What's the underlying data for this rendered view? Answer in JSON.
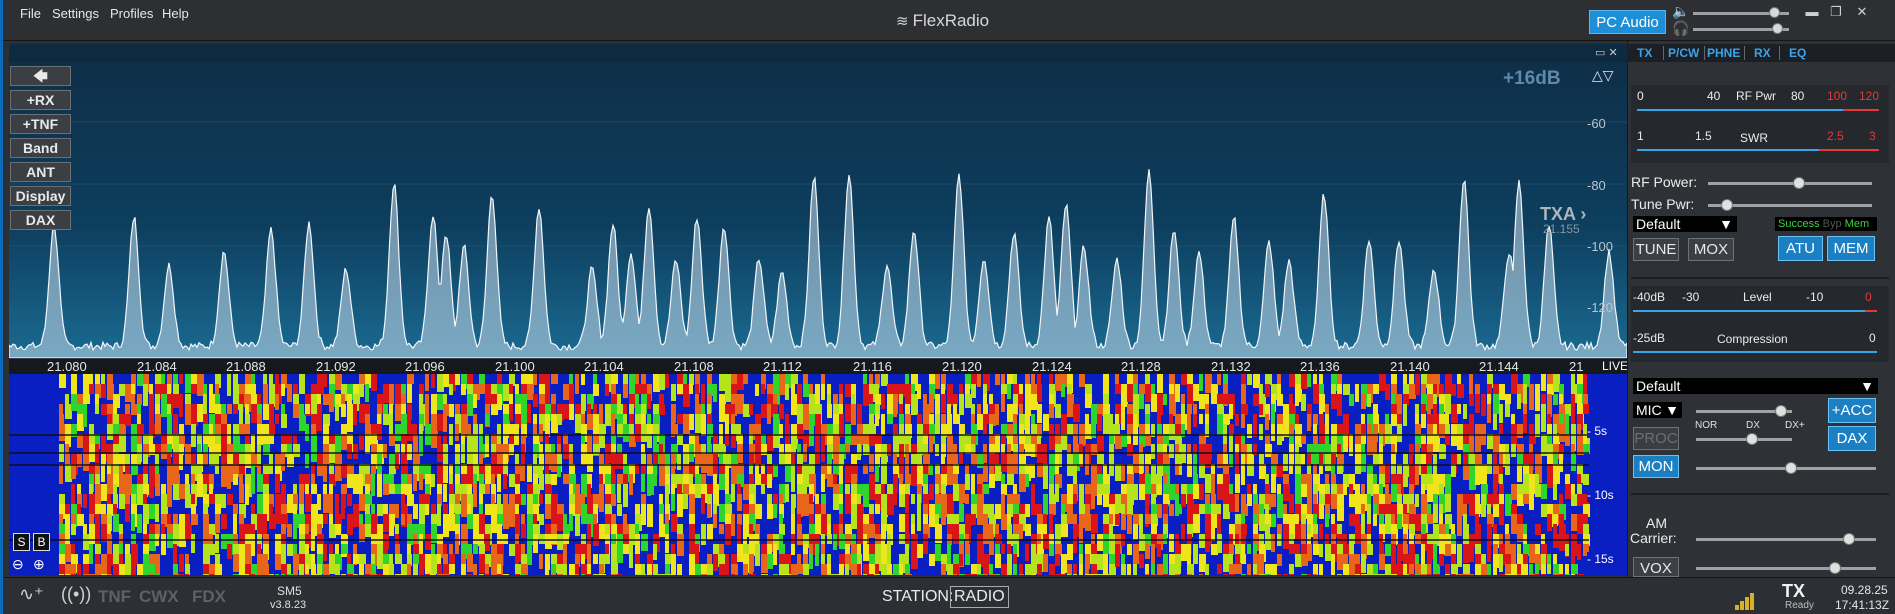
{
  "menu": {
    "items": [
      "File",
      "Settings",
      "Profiles",
      "Help"
    ]
  },
  "brand": "FlexRadio",
  "titlebar": {
    "pc_audio_label": "PC Audio",
    "speaker_icon": "speaker-icon",
    "headphones_icon": "headphones-icon",
    "minimize": "▬",
    "maximize": "❐",
    "close": "✕",
    "colors": {
      "pc_audio_bg": "#1e8fd6",
      "accent_blue": "#3aa4e8"
    }
  },
  "panadapter": {
    "buttons": [
      "+RX",
      "+TNF",
      "Band",
      "ANT",
      "Display",
      "DAX"
    ],
    "collapse_arrow": "🡄",
    "db_offset": "+16dB",
    "db_ticks": [
      "-60",
      "-80",
      "-100",
      "-120"
    ],
    "arrows": "△▽",
    "tx_marker": "TXA ›",
    "tx_freq": "21.155",
    "window_controls": "▭ ✕"
  },
  "frequency_scale": {
    "labels": [
      "21.080",
      "21.084",
      "21.088",
      "21.092",
      "21.096",
      "21.100",
      "21.104",
      "21.108",
      "21.112",
      "21.116",
      "21.120",
      "21.124",
      "21.128",
      "21.132",
      "21.136",
      "21.140",
      "21.144",
      "21"
    ],
    "live": "LIVE"
  },
  "waterfall": {
    "time_marks": [
      "- 5s",
      "- 10s",
      "- 15s"
    ],
    "s_button": "S",
    "b_button": "B",
    "zoom_out_icon": "zoom-out-icon",
    "zoom_in_icon": "zoom-in-icon"
  },
  "statusbar": {
    "tnf": "TNF",
    "cwx": "CWX",
    "fdx": "FDX",
    "callsign": "SM5",
    "version": "v3.8.23",
    "station_label": "STATION:",
    "station_name": "RADIO",
    "tx": "TX",
    "tx_status": "Ready",
    "date": "09.28.25",
    "time": "17:41:13Z"
  },
  "right_panel": {
    "tabs": [
      "TX",
      "P/CW",
      "PHNE",
      "RX",
      "EQ"
    ],
    "rf_pwr_meter": {
      "scale": [
        "0",
        "40",
        "RF Pwr",
        "80",
        "100",
        "120"
      ]
    },
    "swr_meter": {
      "scale": [
        "1",
        "1.5",
        "SWR",
        "2.5",
        "3"
      ]
    },
    "rf_power_label": "RF Power:",
    "rf_power_level": 0.55,
    "tune_pwr_label": "Tune Pwr:",
    "tune_pwr_level": 0.03,
    "tx_profile": "Default",
    "tune_button": "TUNE",
    "mox_button": "MOX",
    "atu_status": [
      "Success",
      "Byp",
      "Mem"
    ],
    "atu_button": "ATU",
    "mem_button": "MEM",
    "level_meter": {
      "scale": [
        "-40dB",
        "-30",
        "Level",
        "-10",
        "0"
      ]
    },
    "compression_meter": {
      "scale": [
        "-25dB",
        "Compression",
        "0"
      ]
    },
    "mic_profile": "Default",
    "mic_source": "MIC",
    "acc_button": "+ACC",
    "proc_button": "PROC",
    "proc_scale": [
      "NOR",
      "DX",
      "DX+"
    ],
    "dax_button": "DAX",
    "mon_button": "MON",
    "am_carrier_label_1": "AM",
    "am_carrier_label_2": "Carrier:",
    "vox_button": "VOX"
  }
}
